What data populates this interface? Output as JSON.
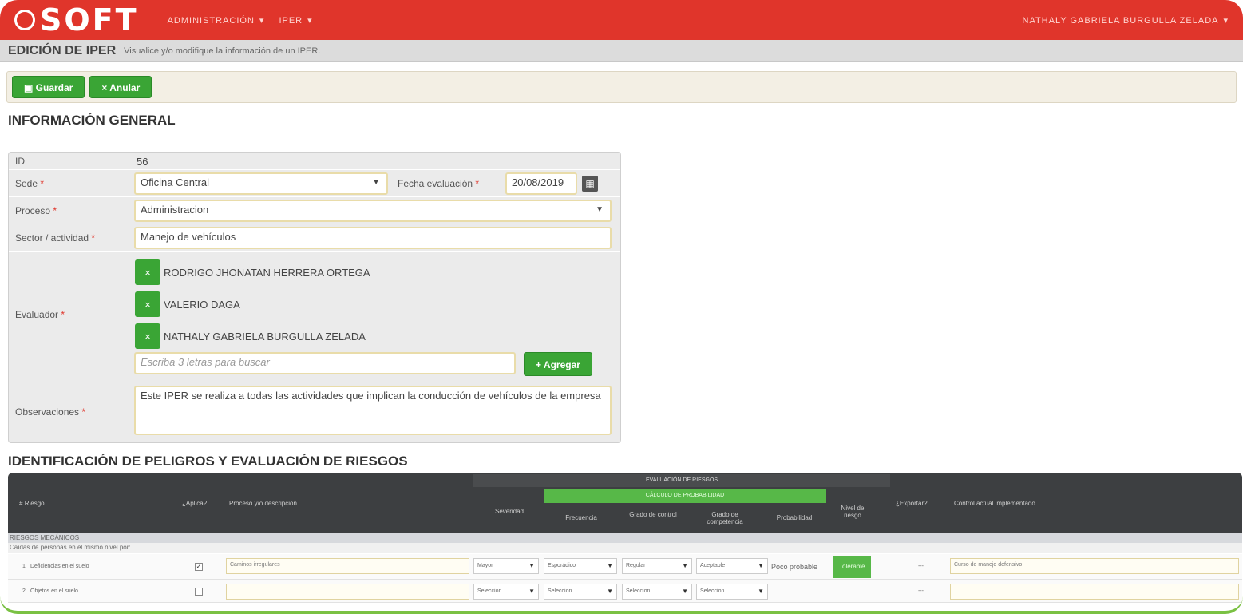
{
  "topbar": {
    "logo": "SOFT",
    "nav": [
      "ADMINISTRACIÓN",
      "IPER"
    ],
    "nav_caret": "▾",
    "user": "NATHALY GABRIELA BURGULLA ZELADA"
  },
  "header": {
    "title": "EDICIÓN DE IPER",
    "description": "Visualice y/o modifique la información de un IPER."
  },
  "toolbar": {
    "save_label": "Guardar",
    "save_icon": "save-icon",
    "cancel_label": "Anular",
    "cancel_icon": "cancel-icon"
  },
  "general": {
    "title": "INFORMACIÓN GENERAL",
    "id_label": "ID",
    "id_value": "56",
    "sede_label": "Sede",
    "sede_value": "Oficina Central",
    "fecha_label": "Fecha evaluación",
    "fecha_value": "20/08/2019",
    "proceso_label": "Proceso",
    "proceso_value": "Administracion",
    "sector_label": "Sector / actividad",
    "sector_value": "Manejo de vehículos",
    "evaluador_label": "Evaluador",
    "evaluadores": [
      "RODRIGO JHONATAN HERRERA ORTEGA",
      "VALERIO DAGA",
      "NATHALY GABRIELA BURGULLA ZELADA"
    ],
    "search_placeholder": "Escriba 3 letras para buscar",
    "add_label": "Agregar",
    "obs_label": "Observaciones",
    "obs_value": "Este IPER se realiza a todas las actividades que implican la conducción de vehículos de la empresa",
    "required_mark": "*"
  },
  "riesgos": {
    "title": "IDENTIFICACIÓN DE PELIGROS Y EVALUACIÓN DE RIESGOS",
    "headers": {
      "num": "#",
      "riesgo": "Riesgo",
      "aplica": "¿Aplica?",
      "proceso": "Proceso y/o descripción",
      "evaluacion": "EVALUACIÓN DE RIESGOS",
      "calculo": "CÁLCULO DE PROBABILIDAD",
      "severidad": "Severidad",
      "frecuencia": "Frecuencia",
      "grado_control": "Grado de control",
      "grado_competencia": "Grado de competencia",
      "probabilidad": "Probabilidad",
      "nivel": "Nivel de riesgo",
      "exportar": "¿Exportar?",
      "control": "Control actual implementado"
    },
    "group": "RIESGOS MECÁNICOS",
    "subgroup": "Caídas de personas en el mismo nivel por:",
    "rows": [
      {
        "num": "1",
        "riesgo": "Deficiencias en el suelo",
        "aplica": true,
        "descripcion": "Caminos irregulares",
        "sev": "Mayor",
        "freq": "Esporádico",
        "ctrl": "Regular",
        "comp": "Aceptable",
        "prob": "Poco probable",
        "nivel": "Tolerable",
        "export": "---",
        "control": "Curso de manejo defensivo"
      },
      {
        "num": "2",
        "riesgo": "Objetos en el suelo",
        "aplica": false,
        "descripcion": "",
        "sev": "Seleccion",
        "freq": "Seleccion",
        "ctrl": "Seleccion",
        "comp": "Seleccion",
        "prob": "",
        "nivel": "",
        "export": "---",
        "control": ""
      }
    ]
  },
  "colors": {
    "brand_red": "#e0352b",
    "green": "#3aa535",
    "dark_header": "#3d3f41"
  }
}
